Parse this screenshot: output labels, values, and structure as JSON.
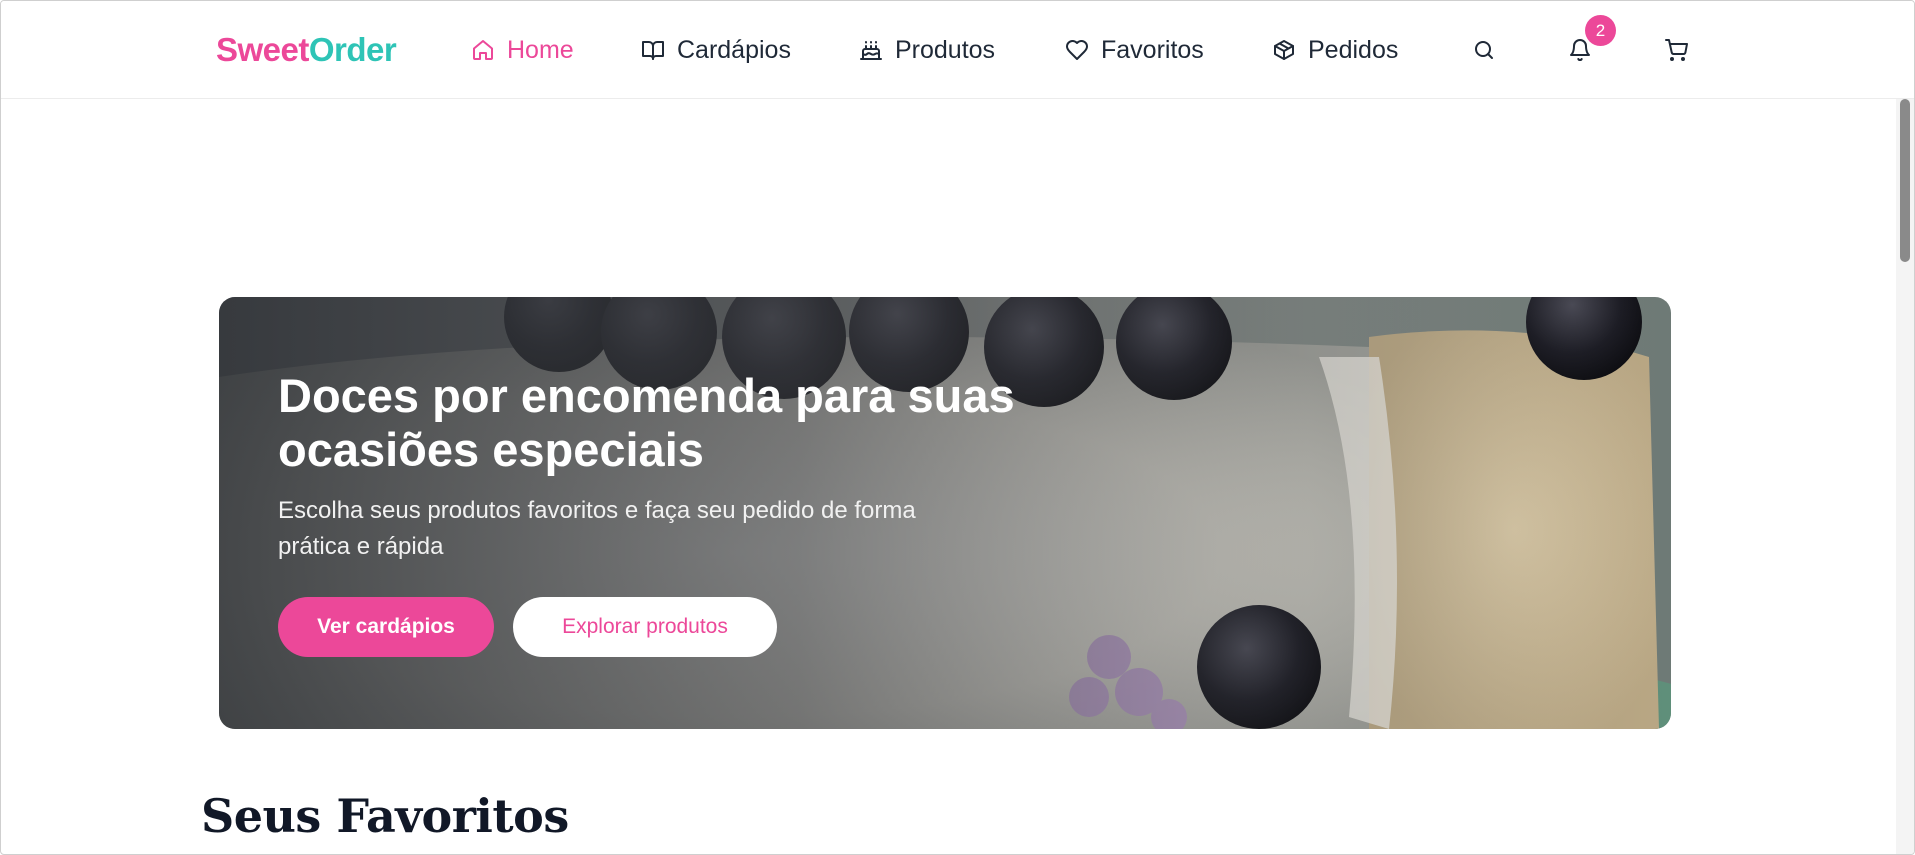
{
  "brand": {
    "part1": "Sweet",
    "part2": "Order",
    "color1": "#ec4899",
    "color2": "#2ec4b6"
  },
  "nav": {
    "items": [
      {
        "label": "Home",
        "icon": "home-icon",
        "active": true
      },
      {
        "label": "Cardápios",
        "icon": "book-open-icon",
        "active": false
      },
      {
        "label": "Produtos",
        "icon": "cake-icon",
        "active": false
      },
      {
        "label": "Favoritos",
        "icon": "heart-icon",
        "active": false
      },
      {
        "label": "Pedidos",
        "icon": "package-icon",
        "active": false
      }
    ],
    "actions": {
      "search_icon": "search-icon",
      "notifications_icon": "bell-icon",
      "notifications_count": "2",
      "cart_icon": "shopping-cart-icon"
    }
  },
  "hero": {
    "title": "Doces por encomenda para suas ocasiões especiais",
    "subtitle": "Escolha seus produtos favoritos e faça seu pedido de forma prática e rápida",
    "primary_button": "Ver cardápios",
    "secondary_button": "Explorar produtos",
    "image": "cake-with-blackberries-photo"
  },
  "sections": {
    "favorites_title": "Seus Favoritos"
  },
  "colors": {
    "accent": "#ec4899",
    "teal": "#2ec4b6",
    "text": "#1f2937"
  }
}
